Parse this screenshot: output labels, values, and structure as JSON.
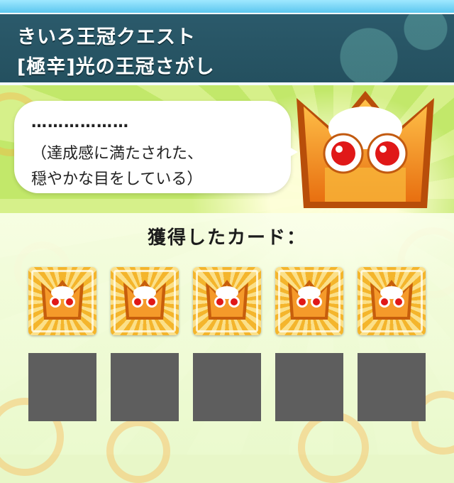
{
  "header": {
    "quest_title": "きいろ王冠クエスト",
    "quest_subtitle": "[極辛]光の王冠さがし"
  },
  "dialogue": {
    "line1": "………………",
    "line2": "（達成感に満たされた、",
    "line3": "穏やかな目をしている）"
  },
  "cards_section": {
    "label": "獲得したカード：",
    "obtained_cards": [
      {
        "icon": "yellow-crown-card-icon"
      },
      {
        "icon": "yellow-crown-card-icon"
      },
      {
        "icon": "yellow-crown-card-icon"
      },
      {
        "icon": "yellow-crown-card-icon"
      },
      {
        "icon": "yellow-crown-card-icon"
      }
    ],
    "empty_slots": 5
  },
  "colors": {
    "header_bg": "#2b5a6b",
    "crown_orange": "#f08a1c",
    "crown_eye_red": "#e01818",
    "empty_slot": "#5e5e5e"
  }
}
